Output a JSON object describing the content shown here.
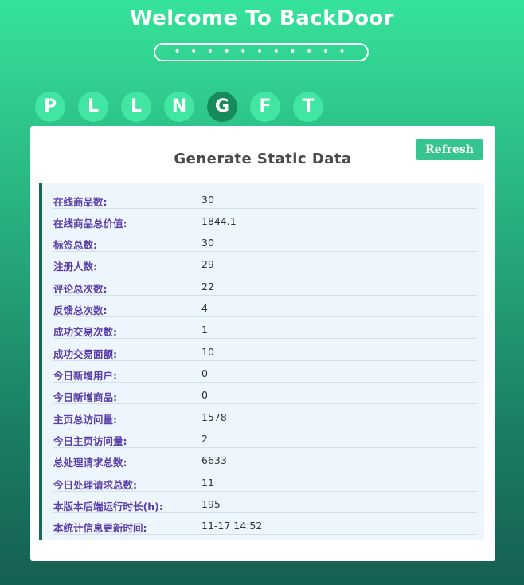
{
  "header": {
    "title": "Welcome To BackDoor",
    "password_mask": "• • • • • • • • • • •"
  },
  "nav": {
    "tabs": [
      {
        "label": "P",
        "active": false
      },
      {
        "label": "L",
        "active": false
      },
      {
        "label": "L",
        "active": false
      },
      {
        "label": "N",
        "active": false
      },
      {
        "label": "G",
        "active": true
      },
      {
        "label": "F",
        "active": false
      },
      {
        "label": "T",
        "active": false
      }
    ]
  },
  "panel": {
    "title": "Generate Static Data",
    "refresh_label": "Refresh",
    "stats": [
      {
        "label": "在线商品数:",
        "value": "30"
      },
      {
        "label": "在线商品总价值:",
        "value": "1844.1"
      },
      {
        "label": "标签总数:",
        "value": "30"
      },
      {
        "label": "注册人数:",
        "value": "29"
      },
      {
        "label": "评论总次数:",
        "value": "22"
      },
      {
        "label": "反馈总次数:",
        "value": "4"
      },
      {
        "label": "成功交易次数:",
        "value": "1"
      },
      {
        "label": "成功交易面额:",
        "value": "10"
      },
      {
        "label": "今日新增用户:",
        "value": "0"
      },
      {
        "label": "今日新增商品:",
        "value": "0"
      },
      {
        "label": "主页总访问量:",
        "value": "1578"
      },
      {
        "label": "今日主页访问量:",
        "value": "2"
      },
      {
        "label": "总处理请求总数:",
        "value": "6633"
      },
      {
        "label": "今日处理请求总数:",
        "value": "11"
      },
      {
        "label": "本版本后端运行时长(h):",
        "value": "195"
      },
      {
        "label": "本统计信息更新时间:",
        "value": "11-17 14:52"
      }
    ]
  },
  "colors": {
    "accent": "#36c48f",
    "tab": "#41e6a2",
    "tab_active": "#168b5b",
    "label": "#5b3fa8"
  }
}
